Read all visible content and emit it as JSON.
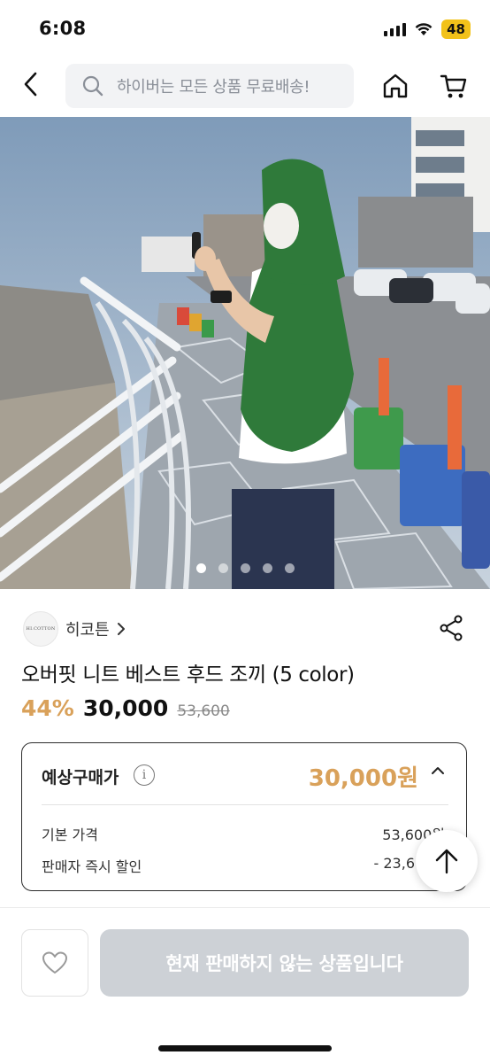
{
  "status_bar": {
    "time": "6:08",
    "battery": "48"
  },
  "header": {
    "search_placeholder": "하이버는 모든 상품 무료배송!"
  },
  "gallery": {
    "total": 5,
    "active_index": 0
  },
  "seller": {
    "logo_text": "HI.COTTON",
    "name": "히코튼"
  },
  "product": {
    "title": "오버핏 니트 베스트 후드 조끼 (5 color)",
    "discount": "44%",
    "price": "30,000",
    "original_price": "53,600"
  },
  "estimate": {
    "label": "예상구매가",
    "price": "30,000원",
    "rows": [
      {
        "label": "기본 가격",
        "value": "53,600원"
      },
      {
        "label": "판매자 즉시 할인",
        "value": "- 23,6"
      }
    ]
  },
  "bottom": {
    "buy_label": "현재 판매하지 않는 상품입니다"
  },
  "colors": {
    "accent": "#d9a15a",
    "disabled": "#cdd1d6"
  }
}
